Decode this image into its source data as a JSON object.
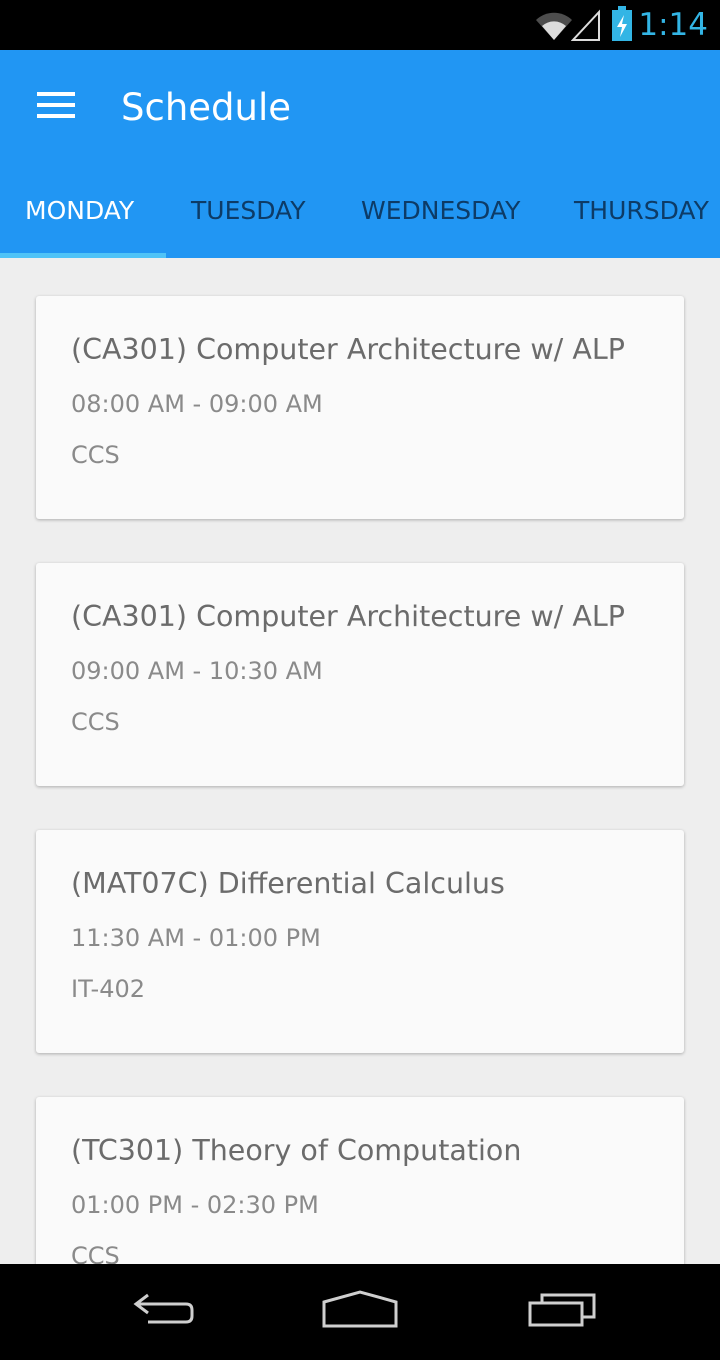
{
  "status_bar": {
    "time": "1:14",
    "icons": [
      "wifi-icon",
      "cell-signal-icon",
      "battery-charging-icon"
    ],
    "accent_color": "#33b5e5"
  },
  "app_bar": {
    "title": "Schedule",
    "menu_icon": "hamburger-menu-icon",
    "color": "#2196f3"
  },
  "tabs": [
    {
      "label": "MONDAY",
      "active": true
    },
    {
      "label": "TUESDAY",
      "active": false
    },
    {
      "label": "WEDNESDAY",
      "active": false
    },
    {
      "label": "THURSDAY",
      "active": false
    }
  ],
  "schedule": [
    {
      "title": "(CA301) Computer Architecture w/ ALP",
      "time": "08:00 AM - 09:00 AM",
      "room": "CCS"
    },
    {
      "title": "(CA301) Computer Architecture w/ ALP",
      "time": "09:00 AM - 10:30 AM",
      "room": "CCS"
    },
    {
      "title": "(MAT07C) Differential Calculus",
      "time": "11:30 AM - 01:00 PM",
      "room": "IT-402"
    },
    {
      "title": "(TC301) Theory of Computation",
      "time": "01:00 PM - 02:30 PM",
      "room": "CCS"
    }
  ],
  "nav_bar": {
    "buttons": [
      "back-icon",
      "home-icon",
      "recent-apps-icon"
    ]
  }
}
